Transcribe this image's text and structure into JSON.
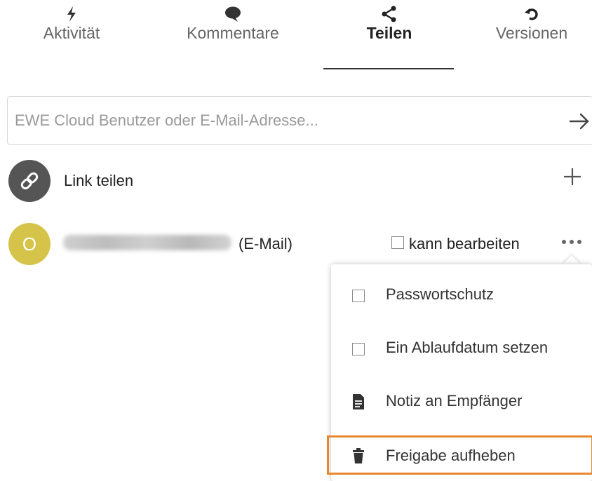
{
  "tabs": [
    {
      "label": "Aktivität",
      "icon": "activity-bolt-icon"
    },
    {
      "label": "Kommentare",
      "icon": "comment-bubble-icon"
    },
    {
      "label": "Teilen",
      "icon": "share-icon",
      "active": true
    },
    {
      "label": "Versionen",
      "icon": "history-icon"
    }
  ],
  "search": {
    "placeholder": "EWE Cloud Benutzer oder E-Mail-Adresse...",
    "value": ""
  },
  "link_share": {
    "label": "Link teilen",
    "icon": "link-icon",
    "action_icon": "plus-icon"
  },
  "user_share": {
    "avatar_letter": "O",
    "type_label": "(E-Mail)",
    "edit_label": "kann bearbeiten",
    "edit_checked": false,
    "more_icon": "more-dots-icon"
  },
  "menu": {
    "items": [
      {
        "label": "Passwortschutz",
        "icon": "checkbox",
        "checked": false
      },
      {
        "label": "Ein Ablaufdatum setzen",
        "icon": "checkbox",
        "checked": false
      },
      {
        "label": "Notiz an Empfänger",
        "icon": "note-document-icon"
      },
      {
        "label": "Freigabe aufheben",
        "icon": "trash-icon",
        "highlighted": true
      }
    ]
  },
  "colors": {
    "avatar_link": "#555555",
    "avatar_user": "#d6c44a",
    "highlight_border": "#e8882e"
  }
}
